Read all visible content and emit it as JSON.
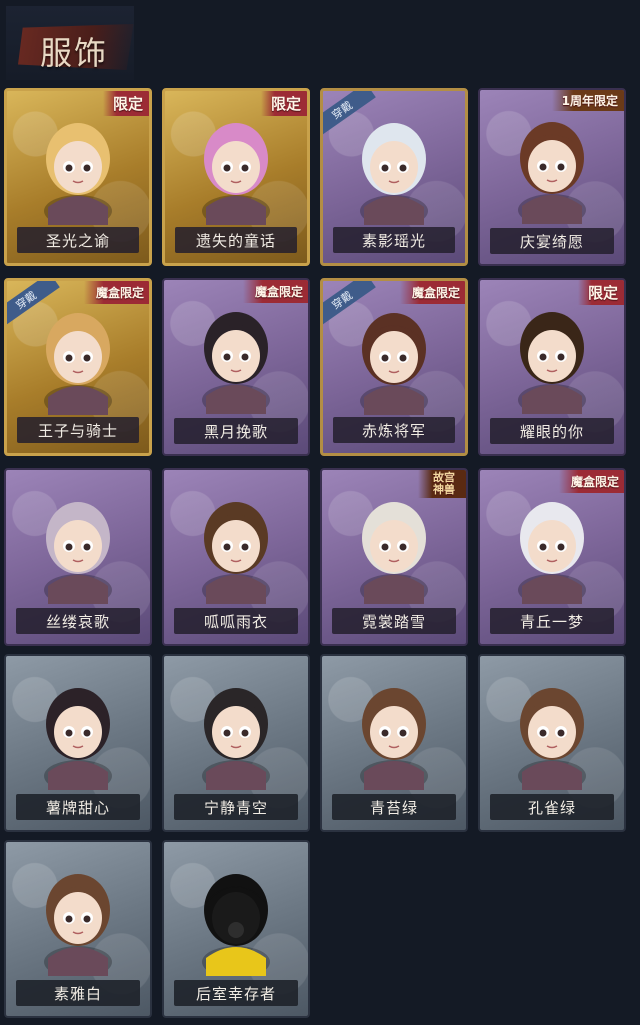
{
  "page_title": "服饰",
  "colors": {
    "background": "#141a25",
    "gold_frame": "#c9a24b",
    "limited_tag": "#9c2b35",
    "wearing_tag": "#3f5c8a"
  },
  "cards": [
    {
      "name": "圣光之谕",
      "style": "gold",
      "tag": "限定",
      "tag_kind": "limited",
      "wearing": false
    },
    {
      "name": "遗失的童话",
      "style": "gold",
      "tag": "限定",
      "tag_kind": "limited",
      "wearing": false
    },
    {
      "name": "素影瑶光",
      "style": "purple-framed",
      "tag": "",
      "tag_kind": "",
      "wearing": true,
      "wear_label": "穿戴"
    },
    {
      "name": "庆宴绮愿",
      "style": "purple",
      "tag": "1周年限定",
      "tag_kind": "anniversary",
      "wearing": false
    },
    {
      "name": "王子与骑士",
      "style": "gold",
      "tag": "魔盒限定",
      "tag_kind": "box",
      "wearing": true,
      "wear_label": "穿戴"
    },
    {
      "name": "黑月挽歌",
      "style": "purple",
      "tag": "魔盒限定",
      "tag_kind": "box",
      "wearing": false
    },
    {
      "name": "赤炼将军",
      "style": "purple-framed",
      "tag": "魔盒限定",
      "tag_kind": "box",
      "wearing": true,
      "wear_label": "穿戴"
    },
    {
      "name": "耀眼的你",
      "style": "purple",
      "tag": "限定",
      "tag_kind": "limited",
      "wearing": false
    },
    {
      "name": "丝缕哀歌",
      "style": "purple",
      "tag": "",
      "tag_kind": "",
      "wearing": false
    },
    {
      "name": "呱呱雨衣",
      "style": "purple",
      "tag": "",
      "tag_kind": "",
      "wearing": false
    },
    {
      "name": "霓裳踏雪",
      "style": "purple",
      "tag": "故宫神兽",
      "tag_kind": "gugong",
      "wearing": false
    },
    {
      "name": "青丘一梦",
      "style": "purple",
      "tag": "魔盒限定",
      "tag_kind": "box",
      "wearing": false
    },
    {
      "name": "薯牌甜心",
      "style": "gray",
      "tag": "",
      "tag_kind": "",
      "wearing": false
    },
    {
      "name": "宁静青空",
      "style": "gray",
      "tag": "",
      "tag_kind": "",
      "wearing": false
    },
    {
      "name": "青苔绿",
      "style": "gray",
      "tag": "",
      "tag_kind": "",
      "wearing": false
    },
    {
      "name": "孔雀绿",
      "style": "gray",
      "tag": "",
      "tag_kind": "",
      "wearing": false
    },
    {
      "name": "素雅白",
      "style": "gray",
      "tag": "",
      "tag_kind": "",
      "wearing": false
    },
    {
      "name": "后室幸存者",
      "style": "gray",
      "tag": "",
      "tag_kind": "",
      "wearing": false
    }
  ]
}
